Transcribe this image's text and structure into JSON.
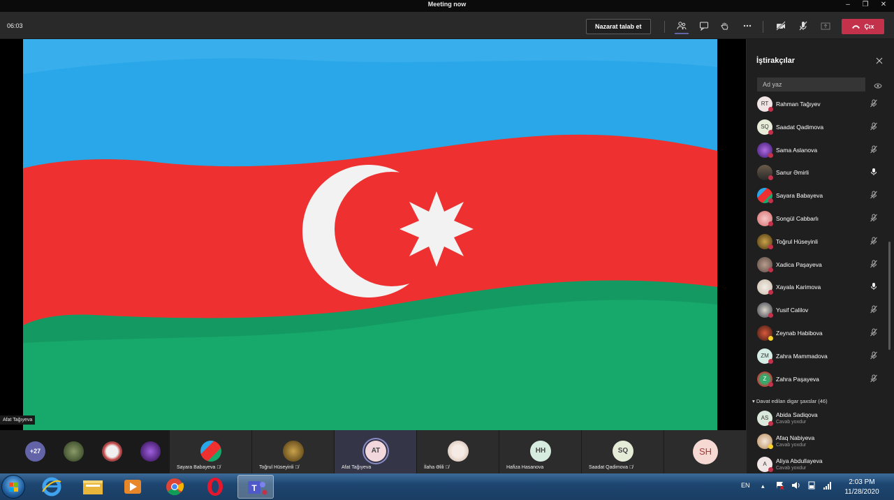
{
  "window": {
    "title": "Meeting now",
    "controls": {
      "minimize": "–",
      "restore": "❐",
      "close": "✕"
    }
  },
  "toolbar": {
    "timer": "06:03",
    "request_control_label": "Nazarat talab et",
    "leave_label": "Çıx",
    "icons": [
      "people-icon",
      "chat-icon",
      "raise-hand-icon",
      "more-icon",
      "camera-off-icon",
      "mic-off-icon",
      "share-icon"
    ],
    "leave_color": "#c4314b"
  },
  "stage": {
    "presenter_name": "Afat Tağıyeva",
    "content": "azerbaijan-flag",
    "flag_colors": [
      "#2aa7e8",
      "#ee3130",
      "#17a86b"
    ]
  },
  "participants_panel": {
    "title": "İştirakçılar",
    "search_placeholder": "Ad yaz",
    "participants": [
      {
        "name": "Rahman Tağıyev",
        "initials": "RT",
        "mic": "muted"
      },
      {
        "name": "Saadat Qadimova",
        "initials": "SQ",
        "mic": "muted"
      },
      {
        "name": "Sama Aslanova",
        "initials": "",
        "mic": "muted"
      },
      {
        "name": "Sanur Əmirli",
        "initials": "",
        "mic": "on"
      },
      {
        "name": "Sayara Babayeva",
        "initials": "",
        "mic": "muted"
      },
      {
        "name": "Songül Cabbarlı",
        "initials": "",
        "mic": "muted"
      },
      {
        "name": "Toğrul Hüseyinli",
        "initials": "",
        "mic": "muted"
      },
      {
        "name": "Xadica Paşayeva",
        "initials": "",
        "mic": "muted"
      },
      {
        "name": "Xayala Karimova",
        "initials": "",
        "mic": "on"
      },
      {
        "name": "Yusif Calilov",
        "initials": "",
        "mic": "muted"
      },
      {
        "name": "Zeynab Habibova",
        "initials": "",
        "mic": "muted"
      },
      {
        "name": "Zahra Mammadova",
        "initials": "ZM",
        "mic": "muted"
      },
      {
        "name": "Zahra Paşayeva",
        "initials": "Z",
        "mic": "muted"
      }
    ],
    "invited_header": "Davat edilan digar şaxslar (46)",
    "invited": [
      {
        "name": "Abida Sadiqova",
        "initials": "AS",
        "status": "Cavab yoxdur"
      },
      {
        "name": "Afaq Nabiyeva",
        "initials": "",
        "status": "Cavab yoxdur"
      },
      {
        "name": "Aliya Abdullayeva",
        "initials": "A",
        "status": "Cavab yoxdur"
      }
    ]
  },
  "gallery": {
    "overflow_count": "+27",
    "tiles": [
      {
        "name": "Sayara Babayeva",
        "initials": "",
        "muted": true
      },
      {
        "name": "Toğrul Hüseyinli",
        "initials": "",
        "muted": true
      },
      {
        "name": "Afat Tağıyeva",
        "initials": "AT",
        "muted": false
      },
      {
        "name": "İlaha Əlili",
        "initials": "",
        "muted": true
      },
      {
        "name": "Hafiza Hasanova",
        "initials": "HH",
        "muted": false
      },
      {
        "name": "Saadat Qadimova",
        "initials": "SQ",
        "muted": true
      },
      {
        "name": "",
        "initials": "SH",
        "muted": false
      }
    ]
  },
  "taskbar": {
    "apps": [
      "ie-icon",
      "explorer-icon",
      "media-player-icon",
      "chrome-icon",
      "opera-icon",
      "teams-icon"
    ],
    "language": "EN",
    "time": "2:03 PM",
    "date": "11/28/2020"
  }
}
